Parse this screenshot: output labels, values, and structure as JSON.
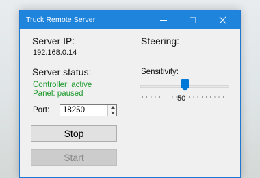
{
  "window": {
    "title": "Truck Remote Server"
  },
  "server": {
    "ip_label": "Server IP:",
    "ip_value": "192.168.0.14",
    "status_label": "Server status:",
    "controller_status": "Controller: active",
    "panel_status": "Panel: paused"
  },
  "port": {
    "label": "Port:",
    "value": "18250"
  },
  "buttons": {
    "stop_label": "Stop",
    "start_label": "Start"
  },
  "steering": {
    "label": "Steering:",
    "sensitivity_label": "Sensitivity:",
    "sensitivity_value": "50",
    "sensitivity_fraction": 0.5
  },
  "colors": {
    "titlebar": "#1e84dc",
    "status_green": "#1f9b2e",
    "slider_thumb": "#0078d7"
  }
}
